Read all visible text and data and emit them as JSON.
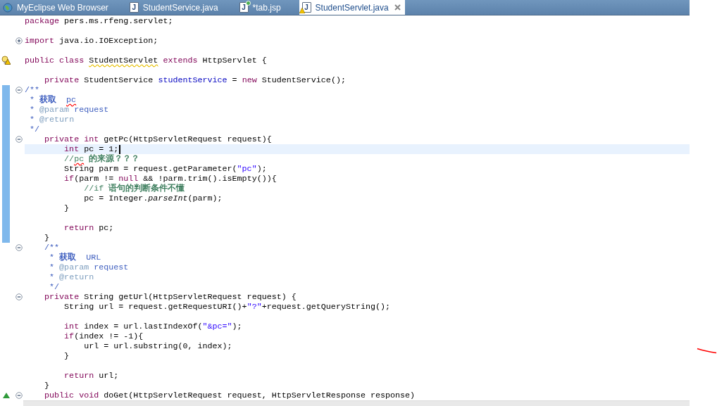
{
  "tabs": [
    {
      "kind": "browser",
      "label": "MyEclipse Web Browser",
      "selected": false,
      "warning": false
    },
    {
      "kind": "java",
      "icon_text": "J",
      "label": "StudentService.java",
      "selected": false,
      "warning": false
    },
    {
      "kind": "jsp",
      "icon_text": "J",
      "label": "*tab.jsp",
      "selected": false,
      "warning": false
    },
    {
      "kind": "java",
      "icon_text": "J",
      "label": "StudentServlet.java",
      "selected": true,
      "warning": true
    }
  ],
  "editor": {
    "lines": [
      {
        "kind": "code",
        "changed": false,
        "current": false,
        "tokens": [
          {
            "kind": "kw",
            "text": "package"
          },
          {
            "kind": "plain",
            "text": " pers.ms.rfeng.servlet;"
          }
        ]
      },
      {
        "kind": "blank",
        "changed": false,
        "current": false
      },
      {
        "kind": "code",
        "changed": false,
        "current": false,
        "foldable": true,
        "folded": true,
        "tokens": [
          {
            "kind": "kw",
            "text": "import"
          },
          {
            "kind": "plain",
            "text": " java.io.IOException;"
          }
        ]
      },
      {
        "kind": "blank",
        "changed": false,
        "current": false
      },
      {
        "kind": "code",
        "changed": false,
        "current": false,
        "warning": true,
        "tokens": [
          {
            "kind": "kw",
            "text": "public class "
          },
          {
            "kind": "plain",
            "text": "StudentServlet",
            "warning_underline": true
          },
          {
            "kind": "kw",
            "text": " extends"
          },
          {
            "kind": "plain",
            "text": " HttpServlet {"
          }
        ]
      },
      {
        "kind": "blank",
        "changed": false,
        "current": false
      },
      {
        "kind": "code",
        "changed": false,
        "current": false,
        "tokens": [
          {
            "kind": "kw",
            "text": "    private"
          },
          {
            "kind": "plain",
            "text": " StudentService "
          },
          {
            "kind": "field",
            "text": "studentService"
          },
          {
            "kind": "plain",
            "text": " = "
          },
          {
            "kind": "kw",
            "text": "new"
          },
          {
            "kind": "plain",
            "text": " StudentService();"
          }
        ]
      },
      {
        "kind": "code",
        "changed": true,
        "current": false,
        "foldable": true,
        "folded": false,
        "tokens": [
          {
            "kind": "doc",
            "text": "/**"
          }
        ]
      },
      {
        "kind": "code",
        "changed": true,
        "current": false,
        "tokens": [
          {
            "kind": "doc",
            "text": " * "
          },
          {
            "kind": "docbold",
            "text": "获取  "
          },
          {
            "kind": "doc",
            "text": "pc",
            "spelling_error": true
          }
        ]
      },
      {
        "kind": "code",
        "changed": true,
        "current": false,
        "tokens": [
          {
            "kind": "doc",
            "text": " * "
          },
          {
            "kind": "doctag",
            "text": "@param"
          },
          {
            "kind": "doc",
            "text": " request"
          }
        ]
      },
      {
        "kind": "code",
        "changed": true,
        "current": false,
        "tokens": [
          {
            "kind": "doc",
            "text": " * "
          },
          {
            "kind": "doctag",
            "text": "@return"
          }
        ]
      },
      {
        "kind": "code",
        "changed": true,
        "current": false,
        "tokens": [
          {
            "kind": "doc",
            "text": " */"
          }
        ]
      },
      {
        "kind": "code",
        "changed": true,
        "current": false,
        "foldable": true,
        "folded": false,
        "tokens": [
          {
            "kind": "kw",
            "text": "    private int"
          },
          {
            "kind": "plain",
            "text": " getPc(HttpServletRequest request){"
          }
        ]
      },
      {
        "kind": "code",
        "changed": true,
        "current": true,
        "tokens": [
          {
            "kind": "kw",
            "text": "        int"
          },
          {
            "kind": "plain",
            "text": " pc = 1;"
          }
        ]
      },
      {
        "kind": "code",
        "changed": true,
        "current": false,
        "tokens": [
          {
            "kind": "comment",
            "text": "        //"
          },
          {
            "kind": "comment",
            "text": "pc",
            "spelling_error": true
          },
          {
            "kind": "commentbold",
            "text": " 的来源？？？"
          }
        ]
      },
      {
        "kind": "code",
        "changed": true,
        "current": false,
        "tokens": [
          {
            "kind": "plain",
            "text": "        String parm = request.getParameter("
          },
          {
            "kind": "str",
            "text": "\"pc\""
          },
          {
            "kind": "plain",
            "text": ");"
          }
        ]
      },
      {
        "kind": "code",
        "changed": true,
        "current": false,
        "tokens": [
          {
            "kind": "kw",
            "text": "        if"
          },
          {
            "kind": "plain",
            "text": "(parm != "
          },
          {
            "kind": "kw",
            "text": "null"
          },
          {
            "kind": "plain",
            "text": " && !parm.trim().isEmpty()){"
          }
        ]
      },
      {
        "kind": "code",
        "changed": true,
        "current": false,
        "tokens": [
          {
            "kind": "comment",
            "text": "            //if"
          },
          {
            "kind": "commentbold",
            "text": " 语句的判断条件不懂"
          }
        ]
      },
      {
        "kind": "code",
        "changed": true,
        "current": false,
        "tokens": [
          {
            "kind": "plain",
            "text": "            pc = Integer."
          },
          {
            "kind": "italic",
            "text": "parseInt"
          },
          {
            "kind": "plain",
            "text": "(parm);"
          }
        ]
      },
      {
        "kind": "code",
        "changed": true,
        "current": false,
        "tokens": [
          {
            "kind": "plain",
            "text": "        }"
          }
        ]
      },
      {
        "kind": "blank",
        "changed": true,
        "current": false
      },
      {
        "kind": "code",
        "changed": true,
        "current": false,
        "tokens": [
          {
            "kind": "kw",
            "text": "        return"
          },
          {
            "kind": "plain",
            "text": " pc;"
          }
        ]
      },
      {
        "kind": "code",
        "changed": true,
        "current": false,
        "tokens": [
          {
            "kind": "plain",
            "text": "    }"
          }
        ]
      },
      {
        "kind": "code",
        "changed": false,
        "current": false,
        "foldable": true,
        "folded": false,
        "tokens": [
          {
            "kind": "doc",
            "text": "    /**"
          }
        ]
      },
      {
        "kind": "code",
        "changed": false,
        "current": false,
        "tokens": [
          {
            "kind": "doc",
            "text": "     * "
          },
          {
            "kind": "docbold",
            "text": "获取"
          },
          {
            "kind": "doc",
            "text": "  URL"
          }
        ]
      },
      {
        "kind": "code",
        "changed": false,
        "current": false,
        "tokens": [
          {
            "kind": "doc",
            "text": "     * "
          },
          {
            "kind": "doctag",
            "text": "@param"
          },
          {
            "kind": "doc",
            "text": " request"
          }
        ]
      },
      {
        "kind": "code",
        "changed": false,
        "current": false,
        "tokens": [
          {
            "kind": "doc",
            "text": "     * "
          },
          {
            "kind": "doctag",
            "text": "@return"
          }
        ]
      },
      {
        "kind": "code",
        "changed": false,
        "current": false,
        "tokens": [
          {
            "kind": "doc",
            "text": "     */"
          }
        ]
      },
      {
        "kind": "code",
        "changed": false,
        "current": false,
        "foldable": true,
        "folded": false,
        "tokens": [
          {
            "kind": "kw",
            "text": "    private"
          },
          {
            "kind": "plain",
            "text": " String getUrl(HttpServletRequest request) {"
          }
        ]
      },
      {
        "kind": "code",
        "changed": false,
        "current": false,
        "tokens": [
          {
            "kind": "plain",
            "text": "        String url = request.getRequestURI()+"
          },
          {
            "kind": "str",
            "text": "\"?\""
          },
          {
            "kind": "plain",
            "text": "+request.getQueryString();"
          }
        ]
      },
      {
        "kind": "blank",
        "changed": false,
        "current": false
      },
      {
        "kind": "code",
        "changed": false,
        "current": false,
        "tokens": [
          {
            "kind": "kw",
            "text": "        int"
          },
          {
            "kind": "plain",
            "text": " index = url.lastIndexOf("
          },
          {
            "kind": "str",
            "text": "\"&pc=\""
          },
          {
            "kind": "plain",
            "text": ");"
          }
        ]
      },
      {
        "kind": "code",
        "changed": false,
        "current": false,
        "tokens": [
          {
            "kind": "kw",
            "text": "        if"
          },
          {
            "kind": "plain",
            "text": "(index != -1){"
          }
        ]
      },
      {
        "kind": "code",
        "changed": false,
        "current": false,
        "tokens": [
          {
            "kind": "plain",
            "text": "            url = url.substring(0, index);"
          }
        ]
      },
      {
        "kind": "code",
        "changed": false,
        "current": false,
        "tokens": [
          {
            "kind": "plain",
            "text": "        }"
          }
        ]
      },
      {
        "kind": "blank",
        "changed": false,
        "current": false
      },
      {
        "kind": "code",
        "changed": false,
        "current": false,
        "tokens": [
          {
            "kind": "kw",
            "text": "        return"
          },
          {
            "kind": "plain",
            "text": " url;"
          }
        ]
      },
      {
        "kind": "code",
        "changed": false,
        "current": false,
        "tokens": [
          {
            "kind": "plain",
            "text": "    }"
          }
        ]
      },
      {
        "kind": "code",
        "changed": false,
        "current": false,
        "foldable": true,
        "folded": false,
        "override": true,
        "tokens": [
          {
            "kind": "kw",
            "text": "    public void"
          },
          {
            "kind": "plain",
            "text": " doGet(HttpServletRequest request, HttpServletResponse response)"
          }
        ]
      }
    ]
  }
}
